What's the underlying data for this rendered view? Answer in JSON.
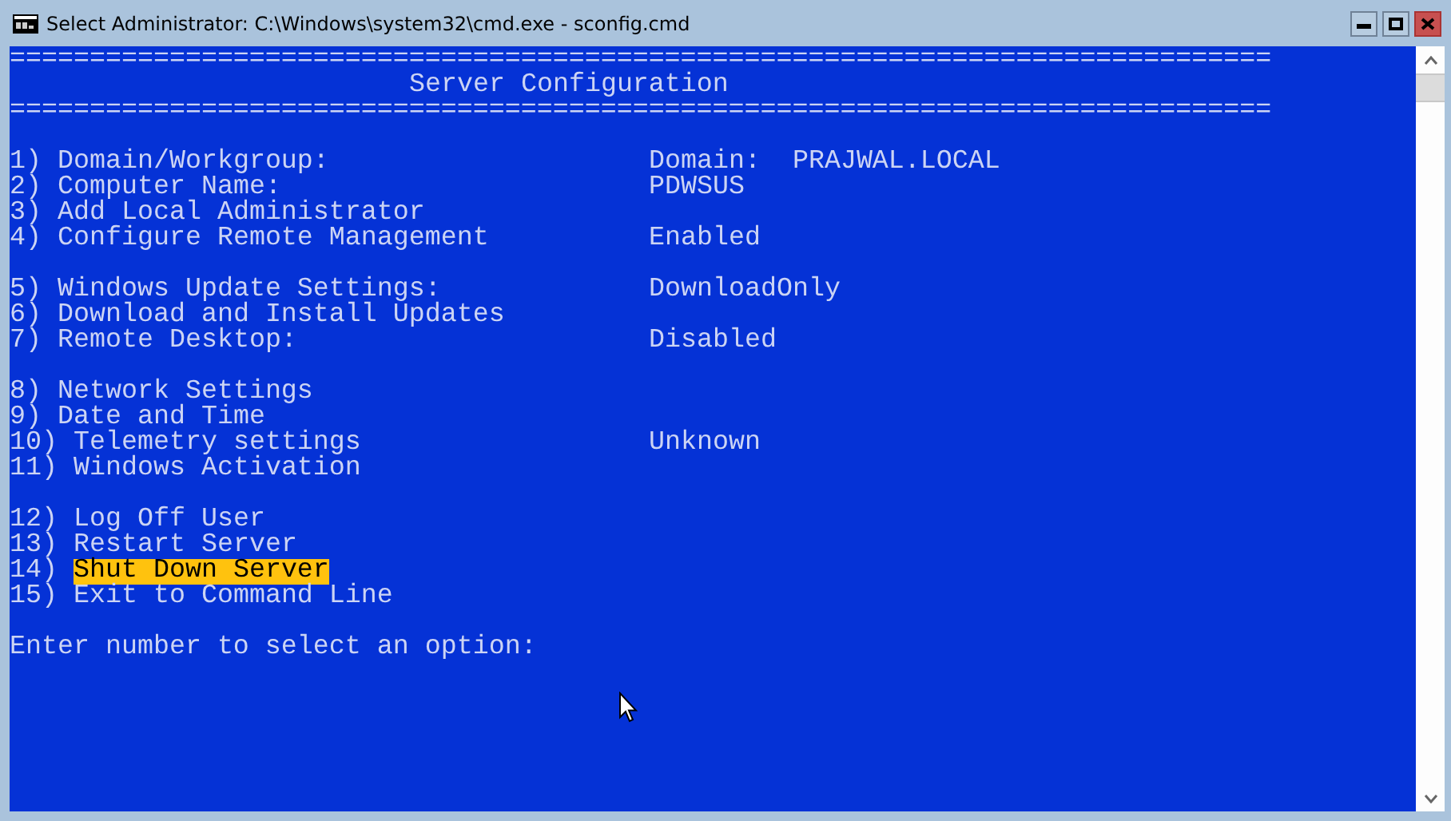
{
  "window": {
    "title": "Select Administrator: C:\\Windows\\system32\\cmd.exe - sconfig.cmd"
  },
  "console": {
    "lines": [
      {
        "kind": "rule",
        "text": "==============================================================================="
      },
      {
        "kind": "title",
        "text": "Server Configuration"
      },
      {
        "kind": "rule",
        "text": "==============================================================================="
      },
      {
        "kind": "blank"
      },
      {
        "kind": "item",
        "number": "1)",
        "label": "Domain/Workgroup:",
        "value": "Domain:  PRAJWAL.LOCAL",
        "selected": false
      },
      {
        "kind": "item",
        "number": "2)",
        "label": "Computer Name:",
        "value": "PDWSUS",
        "selected": false
      },
      {
        "kind": "item",
        "number": "3)",
        "label": "Add Local Administrator",
        "selected": false
      },
      {
        "kind": "item",
        "number": "4)",
        "label": "Configure Remote Management",
        "value": "Enabled",
        "selected": false
      },
      {
        "kind": "blank"
      },
      {
        "kind": "item",
        "number": "5)",
        "label": "Windows Update Settings:",
        "value": "DownloadOnly",
        "selected": false
      },
      {
        "kind": "item",
        "number": "6)",
        "label": "Download and Install Updates",
        "selected": false
      },
      {
        "kind": "item",
        "number": "7)",
        "label": "Remote Desktop:",
        "value": "Disabled",
        "selected": false
      },
      {
        "kind": "blank"
      },
      {
        "kind": "item",
        "number": "8)",
        "label": "Network Settings",
        "selected": false
      },
      {
        "kind": "item",
        "number": "9)",
        "label": "Date and Time",
        "selected": false
      },
      {
        "kind": "item",
        "number": "10)",
        "label": "Telemetry settings",
        "value": "Unknown",
        "selected": false
      },
      {
        "kind": "item",
        "number": "11)",
        "label": "Windows Activation",
        "selected": false
      },
      {
        "kind": "blank"
      },
      {
        "kind": "item",
        "number": "12)",
        "label": "Log Off User",
        "selected": false
      },
      {
        "kind": "item",
        "number": "13)",
        "label": "Restart Server",
        "selected": false
      },
      {
        "kind": "item",
        "number": "14)",
        "label": "Shut Down Server",
        "selected": true
      },
      {
        "kind": "item",
        "number": "15)",
        "label": "Exit to Command Line",
        "selected": false
      },
      {
        "kind": "blank"
      },
      {
        "kind": "prompt",
        "text": "Enter number to select an option:"
      }
    ]
  }
}
